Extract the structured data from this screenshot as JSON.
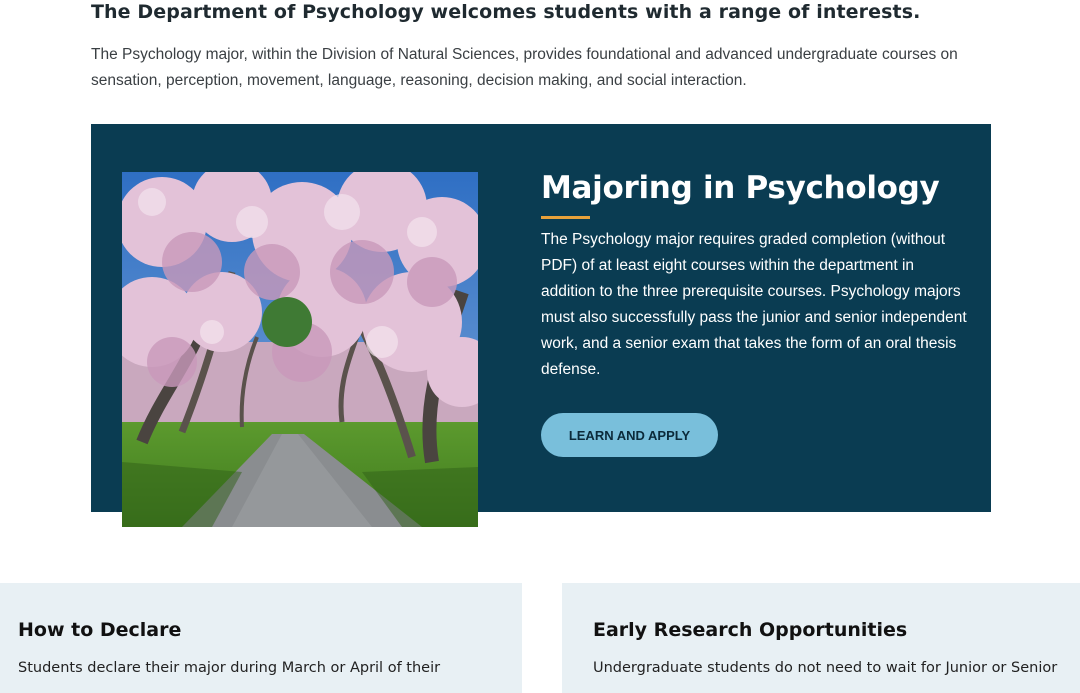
{
  "intro": {
    "heading": "The Department of Psychology welcomes students with a range of interests.",
    "text": "The Psychology major, within the Division of Natural Sciences, provides foundational and advanced undergraduate courses on sensation, perception, movement, language, reasoning, decision making, and social interaction."
  },
  "feature": {
    "title": "Majoring in Psychology",
    "body": "The Psychology major requires graded completion (without PDF) of at least eight courses within the department in addition to the three prerequisite courses. Psychology majors must also successfully pass the junior and senior independent work, and a senior exam that takes the form of an oral thesis defense.",
    "cta_label": "LEARN AND APPLY",
    "colors": {
      "panel": "#0a3c52",
      "accent": "#e8a13a",
      "button": "#79bfdb"
    }
  },
  "cards": [
    {
      "title": "How to Declare",
      "text": "Students declare their major during March or April of their"
    },
    {
      "title": "Early Research Opportunities",
      "text": "Undergraduate students do not need to wait for Junior or Senior"
    }
  ]
}
